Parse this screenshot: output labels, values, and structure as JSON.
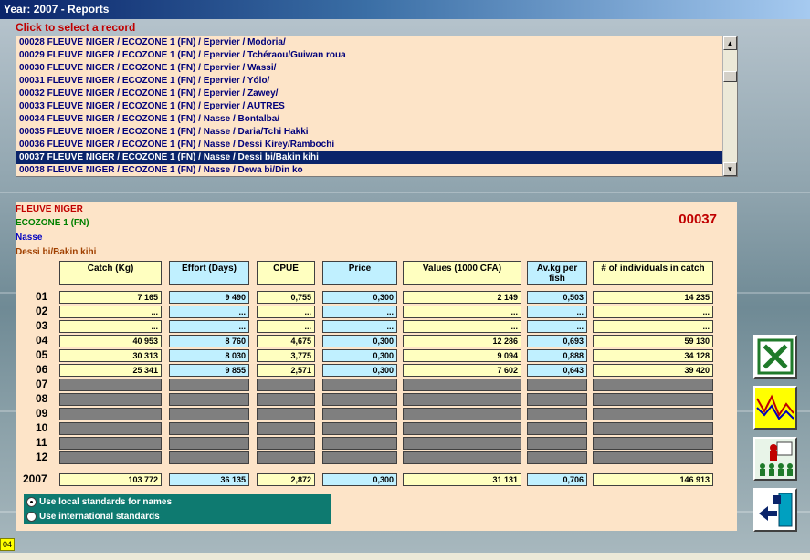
{
  "window": {
    "title": "Year: 2007 - Reports"
  },
  "list_label": "Click to select a record",
  "records": [
    "00028 FLEUVE NIGER / ECOZONE 1 (FN) / Epervier / Modoria/",
    "00029 FLEUVE NIGER / ECOZONE 1 (FN) / Epervier / Tchéraou/Guiwan roua",
    "00030 FLEUVE NIGER / ECOZONE 1 (FN) / Epervier / Wassi/",
    "00031 FLEUVE NIGER / ECOZONE 1 (FN) / Epervier / Yólo/",
    "00032 FLEUVE NIGER / ECOZONE 1 (FN) / Epervier / Zawey/",
    "00033 FLEUVE NIGER / ECOZONE 1 (FN) / Epervier / AUTRES",
    "00034 FLEUVE NIGER / ECOZONE 1 (FN) / Nasse / Bontalba/",
    "00035 FLEUVE NIGER / ECOZONE 1 (FN) / Nasse / Daria/Tchi Hakki",
    "00036 FLEUVE NIGER / ECOZONE 1 (FN) / Nasse / Dessi Kirey/Rambochi",
    "00037 FLEUVE NIGER / ECOZONE 1 (FN) / Nasse / Dessi bi/Bakin kihi",
    "00038 FLEUVE NIGER / ECOZONE 1 (FN) / Nasse / Dewa bi/Din ko"
  ],
  "selected_index": 9,
  "info": {
    "region": "FLEUVE NIGER",
    "ecozone": "ECOZONE 1 (FN)",
    "gear": "Nasse",
    "species": "Dessi bi/Bakin kihi",
    "record_number": "00037"
  },
  "columns": [
    "Catch (Kg)",
    "Effort (Days)",
    "CPUE",
    "Price",
    "Values (1000 CFA)",
    "Av.kg per fish",
    "# of individuals in catch"
  ],
  "rows": [
    {
      "label": "01",
      "values": [
        "7 165",
        "9 490",
        "0,755",
        "0,300",
        "2 149",
        "0,503",
        "14 235"
      ]
    },
    {
      "label": "02",
      "values": [
        "...",
        "...",
        "...",
        "...",
        "...",
        "...",
        "..."
      ]
    },
    {
      "label": "03",
      "values": [
        "...",
        "...",
        "...",
        "...",
        "...",
        "...",
        "..."
      ]
    },
    {
      "label": "04",
      "values": [
        "40 953",
        "8 760",
        "4,675",
        "0,300",
        "12 286",
        "0,693",
        "59 130"
      ]
    },
    {
      "label": "05",
      "values": [
        "30 313",
        "8 030",
        "3,775",
        "0,300",
        "9 094",
        "0,888",
        "34 128"
      ]
    },
    {
      "label": "06",
      "values": [
        "25 341",
        "9 855",
        "2,571",
        "0,300",
        "7 602",
        "0,643",
        "39 420"
      ]
    },
    {
      "label": "07",
      "values": [
        "",
        "",
        "",
        "",
        "",
        "",
        ""
      ]
    },
    {
      "label": "08",
      "values": [
        "",
        "",
        "",
        "",
        "",
        "",
        ""
      ]
    },
    {
      "label": "09",
      "values": [
        "",
        "",
        "",
        "",
        "",
        "",
        ""
      ]
    },
    {
      "label": "10",
      "values": [
        "",
        "",
        "",
        "",
        "",
        "",
        ""
      ]
    },
    {
      "label": "11",
      "values": [
        "",
        "",
        "",
        "",
        "",
        "",
        ""
      ]
    },
    {
      "label": "12",
      "values": [
        "",
        "",
        "",
        "",
        "",
        "",
        ""
      ]
    }
  ],
  "totals": {
    "label": "2007",
    "values": [
      "103 772",
      "36 135",
      "2,872",
      "0,300",
      "31 131",
      "0,706",
      "146 913"
    ]
  },
  "standards": {
    "local": "Use local standards for names",
    "international": "Use international standards",
    "selected": "local"
  },
  "side_buttons": [
    "excel-export-icon",
    "chart-icon",
    "presentation-icon",
    "exit-door-icon"
  ],
  "status": "04",
  "colors": {
    "input_yellow": "#ffffc0",
    "input_blue": "#c0f0ff",
    "empty_gray": "#7f7f7f",
    "panel_bg": "#fde4c8",
    "selection": "#0a246a",
    "radio_bg": "#0e7a70"
  }
}
